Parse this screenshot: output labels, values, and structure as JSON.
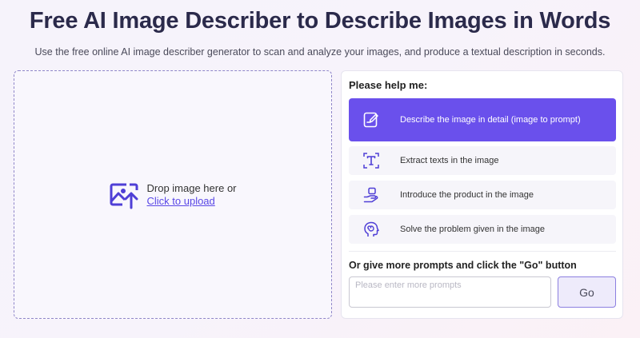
{
  "header": {
    "title": "Free AI Image Describer to Describe Images in Words",
    "subtitle": "Use the free online AI image describer generator to scan and analyze your images, and produce a textual description in seconds."
  },
  "upload": {
    "drop_text": "Drop image here or",
    "link_text": "Click to upload",
    "icon": "image-upload-icon"
  },
  "panel": {
    "heading": "Please help me:",
    "options": [
      {
        "label": "Describe the image in detail (image to prompt)",
        "icon": "edit-document-icon",
        "selected": true
      },
      {
        "label": "Extract texts in the image",
        "icon": "text-scan-icon",
        "selected": false
      },
      {
        "label": "Introduce the product in the image",
        "icon": "product-hand-icon",
        "selected": false
      },
      {
        "label": "Solve the problem given in the image",
        "icon": "brain-head-icon",
        "selected": false
      }
    ],
    "prompt_heading": "Or give more prompts and click the \"Go\" button",
    "prompt_placeholder": "Please enter more prompts",
    "prompt_value": "",
    "go_label": "Go"
  },
  "colors": {
    "accent": "#6a50ec",
    "title": "#2b2a4b",
    "link": "#5a48e6",
    "upload_border": "#8f86c9"
  }
}
